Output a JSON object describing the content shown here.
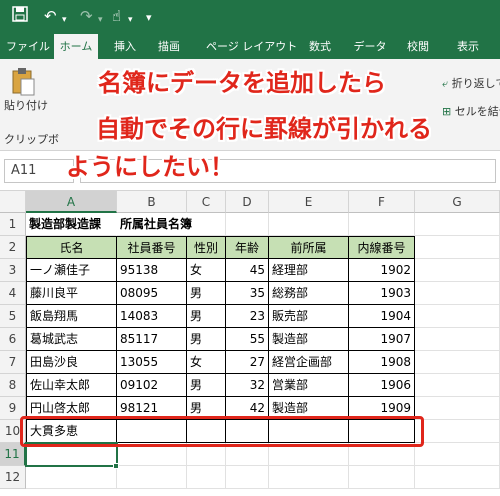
{
  "qat": {
    "save_icon": "save-icon",
    "undo_icon": "undo-icon",
    "redo_icon": "redo-icon",
    "touch_icon": "touch-mode-icon",
    "customize_icon": "chevron-down-icon"
  },
  "tabs": [
    "ファイル",
    "ホーム",
    "挿入",
    "描画",
    "ページ レイアウト",
    "数式",
    "データ",
    "校閲",
    "表示"
  ],
  "active_tab": "ホーム",
  "ribbon": {
    "paste_label": "貼り付け",
    "clipboard_label": "クリップボ",
    "wrap_text_label": "折り返して",
    "merge_label": "セルを結合"
  },
  "formula_bar": {
    "name_box": "A11",
    "value": ""
  },
  "callout": {
    "line1": "名簿にデータを追加したら",
    "line2": "自動でその行に罫線が引かれる",
    "line3": "ようにしたい！"
  },
  "sheet": {
    "columns": [
      "A",
      "B",
      "C",
      "D",
      "E",
      "F",
      "G"
    ],
    "rows": [
      "1",
      "2",
      "3",
      "4",
      "5",
      "6",
      "7",
      "8",
      "9",
      "10",
      "11",
      "12"
    ],
    "title_a": "製造部製造課",
    "title_b": "所属社員名簿",
    "headers": [
      "氏名",
      "社員番号",
      "性別",
      "年齢",
      "前所属",
      "内線番号"
    ],
    "records": [
      [
        "一ノ瀬佳子",
        "95138",
        "女",
        "45",
        "経理部",
        "1902"
      ],
      [
        "藤川良平",
        "08095",
        "男",
        "35",
        "総務部",
        "1903"
      ],
      [
        "飯島翔馬",
        "14083",
        "男",
        "23",
        "販売部",
        "1904"
      ],
      [
        "葛城武志",
        "85117",
        "男",
        "55",
        "製造部",
        "1907"
      ],
      [
        "田島沙良",
        "13055",
        "女",
        "27",
        "経営企画部",
        "1908"
      ],
      [
        "佐山幸太郎",
        "09102",
        "男",
        "32",
        "営業部",
        "1906"
      ],
      [
        "円山啓太郎",
        "98121",
        "男",
        "42",
        "製造部",
        "1909"
      ],
      [
        "大貫多恵",
        "",
        "",
        "",
        "",
        ""
      ]
    ]
  },
  "colors": {
    "excel_green": "#217346",
    "header_fill": "#c6e0b4",
    "callout_red": "#e0261b"
  }
}
